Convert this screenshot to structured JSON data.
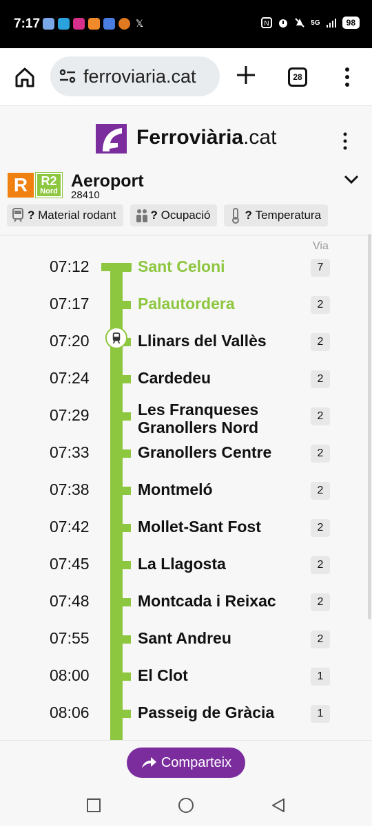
{
  "status_bar": {
    "time": "7:17",
    "network": "5G",
    "battery": "98"
  },
  "browser": {
    "url": "ferroviaria.cat",
    "tab_count": "28"
  },
  "site": {
    "logo_bold": "Ferroviària",
    "logo_light": ".cat"
  },
  "route": {
    "badge_r": "R",
    "badge_line": "R2",
    "badge_sub": "Nord",
    "destination": "Aeroport",
    "train_number": "28410"
  },
  "chips": [
    {
      "icon": "train-icon",
      "label": "Material rodant",
      "marker": "?"
    },
    {
      "icon": "people-icon",
      "label": "Ocupació",
      "marker": "?"
    },
    {
      "icon": "thermometer-icon",
      "label": "Temperatura",
      "marker": "?"
    }
  ],
  "via_header": "Via",
  "stops": [
    {
      "time": "07:12",
      "name": "Sant Celoni",
      "via": "7",
      "passed": true
    },
    {
      "time": "07:17",
      "name": "Palautordera",
      "via": "2",
      "passed": true
    },
    {
      "time": "07:20",
      "name": "Llinars del Vallès",
      "via": "2",
      "passed": false
    },
    {
      "time": "07:24",
      "name": "Cardedeu",
      "via": "2",
      "passed": false
    },
    {
      "time": "07:29",
      "name": "Les Franqueses Granollers Nord",
      "via": "2",
      "passed": false
    },
    {
      "time": "07:33",
      "name": "Granollers Centre",
      "via": "2",
      "passed": false
    },
    {
      "time": "07:38",
      "name": "Montmeló",
      "via": "2",
      "passed": false
    },
    {
      "time": "07:42",
      "name": "Mollet-Sant Fost",
      "via": "2",
      "passed": false
    },
    {
      "time": "07:45",
      "name": "La Llagosta",
      "via": "2",
      "passed": false
    },
    {
      "time": "07:48",
      "name": "Montcada i Reixac",
      "via": "2",
      "passed": false
    },
    {
      "time": "07:55",
      "name": "Sant Andreu",
      "via": "2",
      "passed": false
    },
    {
      "time": "08:00",
      "name": "El Clot",
      "via": "1",
      "passed": false
    },
    {
      "time": "08:06",
      "name": "Passeig de Gràcia",
      "via": "1",
      "passed": false
    }
  ],
  "share_label": "Comparteix",
  "colors": {
    "line_green": "#8dc63f",
    "brand_purple": "#7b2d9e",
    "rodalies_orange": "#f08010"
  }
}
